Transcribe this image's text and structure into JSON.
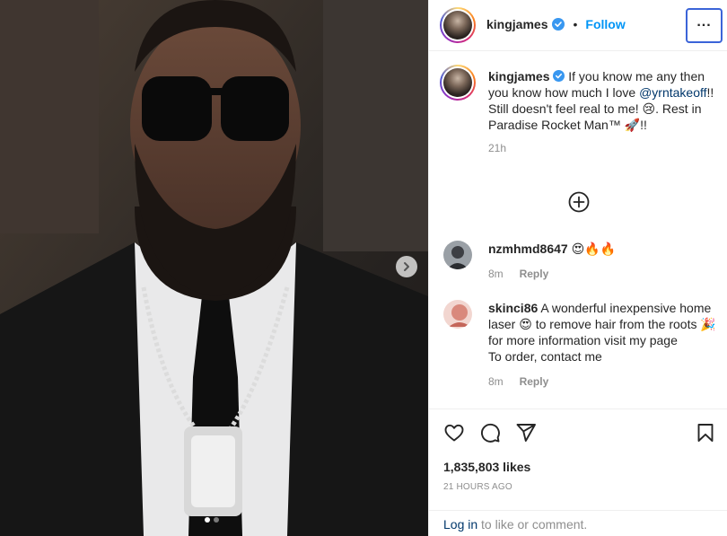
{
  "post": {
    "image_alt": "Photo of man in black suit and sunglasses wearing a chain pendant",
    "carousel": {
      "total": 2,
      "current": 1
    }
  },
  "header": {
    "username": "kingjames",
    "separator": "•",
    "follow_label": "Follow",
    "more_label": "..."
  },
  "caption": {
    "username": "kingjames",
    "text_before": " If you know me any then you know how much I love ",
    "mention": "@yrntakeoff",
    "text_after": "!! Still doesn't feel real to me! 😢. Rest in Paradise Rocket Man™ 🚀!!",
    "time": "21h"
  },
  "comments": [
    {
      "username": "nzmhmd8647",
      "text": " 😍🔥🔥",
      "time": "8m",
      "reply_label": "Reply"
    },
    {
      "username": "skinci86",
      "text": " A wonderful inexpensive home laser 😍 to remove hair from the roots 🎉 for more information visit my page",
      "text2": "To order, contact me",
      "time": "8m",
      "reply_label": "Reply"
    }
  ],
  "actions": {
    "likes": "1,835,803 likes",
    "time_ago": "21 HOURS AGO",
    "login_link": "Log in",
    "login_text": " to like or comment."
  },
  "colors": {
    "accent": "#0095f6",
    "link": "#00376b",
    "muted": "#8e8e8e",
    "focus": "#3b64d8"
  }
}
